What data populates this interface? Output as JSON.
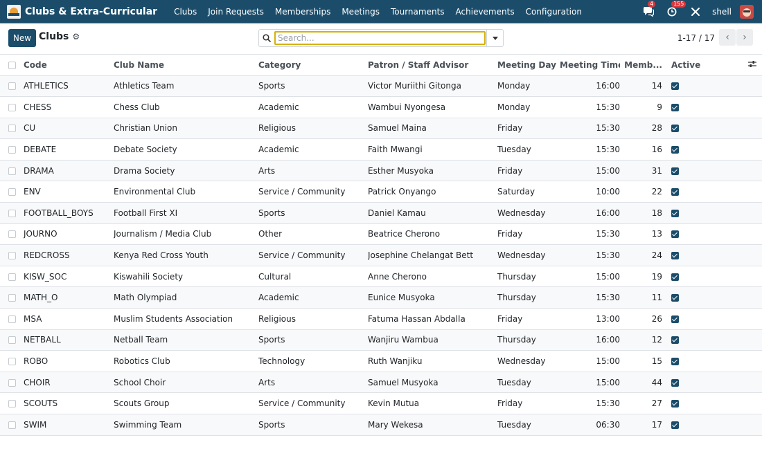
{
  "app": {
    "title": "Clubs & Extra-Curricular",
    "menu": [
      "Clubs",
      "Join Requests",
      "Memberships",
      "Meetings",
      "Tournaments",
      "Achievements",
      "Configuration"
    ],
    "messages_count": "4",
    "activities_count": "155",
    "user_name": "shell",
    "accent_color": "#1b4d6b"
  },
  "control": {
    "new_label": "New",
    "breadcrumb": "Clubs",
    "search_placeholder": "Search...",
    "pager": "1-17 / 17"
  },
  "table": {
    "columns": [
      "Code",
      "Club Name",
      "Category",
      "Patron / Staff Advisor",
      "Meeting Day",
      "Meeting Time",
      "Memb...",
      "Active"
    ],
    "rows": [
      {
        "code": "ATHLETICS",
        "name": "Athletics Team",
        "category": "Sports",
        "patron": "Victor Muriithi Gitonga",
        "day": "Monday",
        "time": "16:00",
        "members": "14",
        "active": true
      },
      {
        "code": "CHESS",
        "name": "Chess Club",
        "category": "Academic",
        "patron": "Wambui Nyongesa",
        "day": "Monday",
        "time": "15:30",
        "members": "9",
        "active": true
      },
      {
        "code": "CU",
        "name": "Christian Union",
        "category": "Religious",
        "patron": "Samuel Maina",
        "day": "Friday",
        "time": "15:30",
        "members": "28",
        "active": true
      },
      {
        "code": "DEBATE",
        "name": "Debate Society",
        "category": "Academic",
        "patron": "Faith Mwangi",
        "day": "Tuesday",
        "time": "15:30",
        "members": "16",
        "active": true
      },
      {
        "code": "DRAMA",
        "name": "Drama Society",
        "category": "Arts",
        "patron": "Esther Musyoka",
        "day": "Friday",
        "time": "15:00",
        "members": "31",
        "active": true
      },
      {
        "code": "ENV",
        "name": "Environmental Club",
        "category": "Service / Community",
        "patron": "Patrick Onyango",
        "day": "Saturday",
        "time": "10:00",
        "members": "22",
        "active": true
      },
      {
        "code": "FOOTBALL_BOYS",
        "name": "Football First XI",
        "category": "Sports",
        "patron": "Daniel Kamau",
        "day": "Wednesday",
        "time": "16:00",
        "members": "18",
        "active": true
      },
      {
        "code": "JOURNO",
        "name": "Journalism / Media Club",
        "category": "Other",
        "patron": "Beatrice Cherono",
        "day": "Friday",
        "time": "15:30",
        "members": "13",
        "active": true
      },
      {
        "code": "REDCROSS",
        "name": "Kenya Red Cross Youth",
        "category": "Service / Community",
        "patron": "Josephine Chelangat Bett",
        "day": "Wednesday",
        "time": "15:30",
        "members": "24",
        "active": true
      },
      {
        "code": "KISW_SOC",
        "name": "Kiswahili Society",
        "category": "Cultural",
        "patron": "Anne Cherono",
        "day": "Thursday",
        "time": "15:00",
        "members": "19",
        "active": true
      },
      {
        "code": "MATH_O",
        "name": "Math Olympiad",
        "category": "Academic",
        "patron": "Eunice Musyoka",
        "day": "Thursday",
        "time": "15:30",
        "members": "11",
        "active": true
      },
      {
        "code": "MSA",
        "name": "Muslim Students Association",
        "category": "Religious",
        "patron": "Fatuma Hassan Abdalla",
        "day": "Friday",
        "time": "13:00",
        "members": "26",
        "active": true
      },
      {
        "code": "NETBALL",
        "name": "Netball Team",
        "category": "Sports",
        "patron": "Wanjiru Wambua",
        "day": "Thursday",
        "time": "16:00",
        "members": "12",
        "active": true
      },
      {
        "code": "ROBO",
        "name": "Robotics Club",
        "category": "Technology",
        "patron": "Ruth Wanjiku",
        "day": "Wednesday",
        "time": "15:00",
        "members": "15",
        "active": true
      },
      {
        "code": "CHOIR",
        "name": "School Choir",
        "category": "Arts",
        "patron": "Samuel Musyoka",
        "day": "Tuesday",
        "time": "15:00",
        "members": "44",
        "active": true
      },
      {
        "code": "SCOUTS",
        "name": "Scouts Group",
        "category": "Service / Community",
        "patron": "Kevin Mutua",
        "day": "Friday",
        "time": "15:30",
        "members": "27",
        "active": true
      },
      {
        "code": "SWIM",
        "name": "Swimming Team",
        "category": "Sports",
        "patron": "Mary Wekesa",
        "day": "Tuesday",
        "time": "06:30",
        "members": "17",
        "active": true
      }
    ]
  }
}
